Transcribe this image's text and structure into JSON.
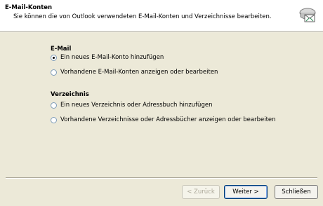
{
  "header": {
    "title": "E-Mail-Konten",
    "subtitle": "Sie können die von Outlook verwendeten E-Mail-Konten und Verzeichnisse bearbeiten.",
    "icon": "email-accounts-icon"
  },
  "email_section": {
    "title": "E-Mail",
    "options": [
      {
        "label": "Ein neues E-Mail-Konto hinzufügen",
        "checked": true
      },
      {
        "label": "Vorhandene E-Mail-Konten anzeigen oder bearbeiten",
        "checked": false
      }
    ]
  },
  "directory_section": {
    "title": "Verzeichnis",
    "options": [
      {
        "label": "Ein neues Verzeichnis oder Adressbuch hinzufügen",
        "checked": false
      },
      {
        "label": "Vorhandene Verzeichnisse oder Adressbücher anzeigen oder bearbeiten",
        "checked": false
      }
    ]
  },
  "buttons": {
    "back": "< Zurück",
    "next": "Weiter >",
    "close": "Schließen"
  },
  "colors": {
    "dialog_background": "#ECE9D8",
    "header_background": "#FFFFFF"
  }
}
